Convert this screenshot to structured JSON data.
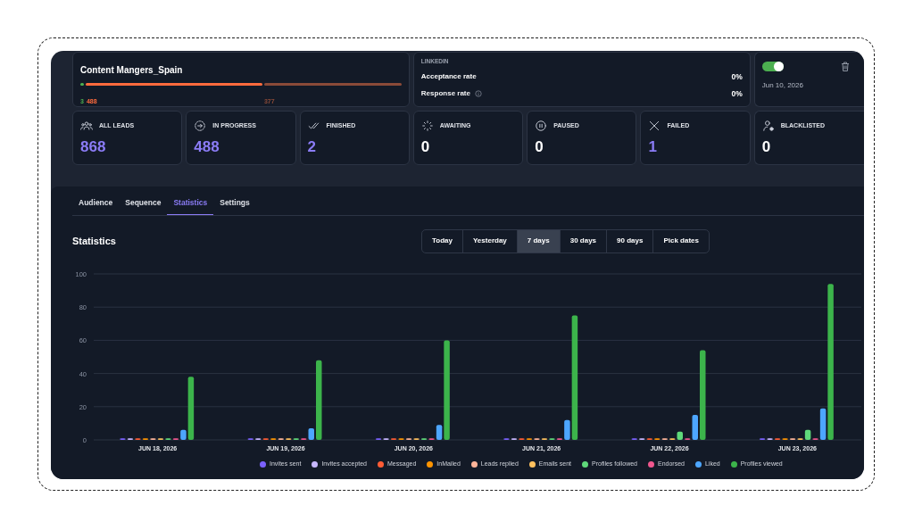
{
  "campaign": {
    "name": "Content Mangers_Spain",
    "segments": [
      {
        "label": "3",
        "color": "#4caf50"
      },
      {
        "label": "488",
        "color": "#ff6b3d"
      },
      {
        "label": "377",
        "color": "#8a4a38"
      }
    ]
  },
  "linkedin": {
    "title": "LINKEDIN",
    "rates": [
      {
        "label": "Acceptance rate",
        "value": "0%",
        "info": false
      },
      {
        "label": "Response rate",
        "value": "0%",
        "info": true
      }
    ]
  },
  "status": {
    "on": true,
    "date": "Jun 10, 2026"
  },
  "stats": [
    {
      "kind": "all",
      "label": "ALL LEADS",
      "value": "868",
      "accent": true
    },
    {
      "kind": "progress",
      "label": "IN PROGRESS",
      "value": "488",
      "accent": true
    },
    {
      "kind": "finished",
      "label": "FINISHED",
      "value": "2",
      "accent": true
    },
    {
      "kind": "awaiting",
      "label": "AWAITING",
      "value": "0",
      "accent": false
    },
    {
      "kind": "paused",
      "label": "PAUSED",
      "value": "0",
      "accent": false
    },
    {
      "kind": "failed",
      "label": "FAILED",
      "value": "1",
      "accent": true
    },
    {
      "kind": "blacklisted",
      "label": "BLACKLISTED",
      "value": "0",
      "accent": false
    }
  ],
  "tabs": [
    {
      "label": "Audience",
      "selected": false
    },
    {
      "label": "Sequence",
      "selected": false
    },
    {
      "label": "Statistics",
      "selected": true
    },
    {
      "label": "Settings",
      "selected": false
    }
  ],
  "section_title": "Statistics",
  "ranges": [
    {
      "label": "Today",
      "selected": false
    },
    {
      "label": "Yesterday",
      "selected": false
    },
    {
      "label": "7 days",
      "selected": true
    },
    {
      "label": "30 days",
      "selected": false
    },
    {
      "label": "90 days",
      "selected": false
    },
    {
      "label": "Pick dates",
      "selected": false
    }
  ],
  "chart_data": {
    "type": "bar",
    "grid": true,
    "categories": [
      "JUN 18, 2026",
      "JUN 19, 2026",
      "JUN 20, 2026",
      "JUN 21, 2026",
      "JUN 22, 2026",
      "JUN 23, 2026"
    ],
    "ylim": [
      0,
      100
    ],
    "yticks": [
      0,
      20,
      40,
      60,
      80,
      100
    ],
    "series": [
      {
        "name": "Invites sent",
        "color": "#7b61ff",
        "values": [
          1,
          1,
          1,
          1,
          1,
          1
        ]
      },
      {
        "name": "Invites accepted",
        "color": "#c8b8ff",
        "values": [
          1,
          1,
          1,
          1,
          1,
          1
        ]
      },
      {
        "name": "Messaged",
        "color": "#ff5c35",
        "values": [
          1,
          1,
          1,
          1,
          1,
          1
        ]
      },
      {
        "name": "InMailed",
        "color": "#ff9500",
        "values": [
          1,
          1,
          1,
          1,
          1,
          1
        ]
      },
      {
        "name": "Leads replied",
        "color": "#ffb59a",
        "values": [
          1,
          1,
          1,
          1,
          1,
          1
        ]
      },
      {
        "name": "Emails sent",
        "color": "#ffc15e",
        "values": [
          1,
          1,
          1,
          1,
          1,
          1
        ]
      },
      {
        "name": "Profiles followed",
        "color": "#5fd97a",
        "values": [
          1,
          1,
          1,
          1,
          5,
          6
        ]
      },
      {
        "name": "Endorsed",
        "color": "#f0578e",
        "values": [
          1,
          1,
          1,
          1,
          1,
          1
        ]
      },
      {
        "name": "Liked",
        "color": "#4da6ff",
        "values": [
          6,
          7,
          9,
          12,
          15,
          19
        ]
      },
      {
        "name": "Profiles viewed",
        "color": "#3cb44b",
        "values": [
          38,
          48,
          60,
          75,
          54,
          94
        ]
      }
    ]
  }
}
